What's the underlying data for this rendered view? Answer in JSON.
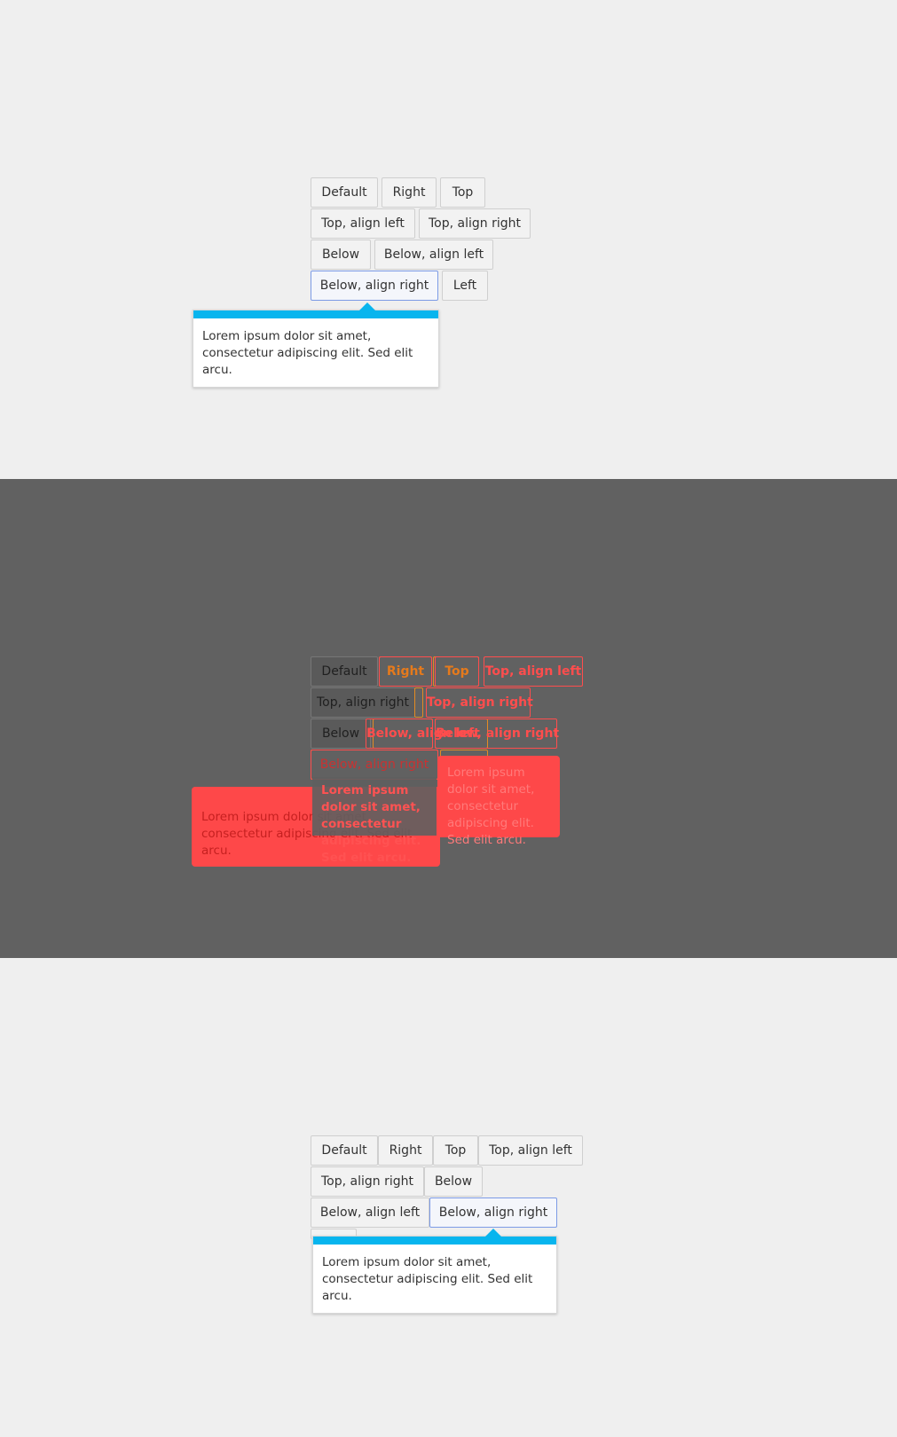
{
  "panel_top": {
    "buttons": [
      "Default",
      "Right",
      "Top",
      "Top, align left",
      "Top, align right",
      "Below",
      "Below, align left",
      "Below, align right",
      "Left"
    ],
    "popover_text": "Lorem ipsum dolor sit amet, consectetur adipiscing elit. Sed elit arcu."
  },
  "panel_overlay": {
    "buttons": [
      "Default",
      "Right",
      "Top",
      "Top, align left",
      "Top, align right",
      "Below",
      "Below, align left",
      "Below, align right",
      "Left"
    ],
    "popover_text": "Lorem ipsum dolor sit amet, consectetur adipiscing elit. Sed elit arcu."
  },
  "panel_bottom": {
    "buttons": [
      "Default",
      "Right",
      "Top",
      "Top, align left",
      "Top, align right",
      "Below",
      "Below, align left",
      "Below, align right"
    ],
    "popover_text": "Lorem ipsum dolor sit amet, consectetur adipiscing elit. Sed elit arcu."
  },
  "colors": {
    "accent": "#08b5ee",
    "focus_border": "#7c9be6",
    "overlay_red": "#fe4849",
    "overlay_orange": "#e38b23"
  }
}
